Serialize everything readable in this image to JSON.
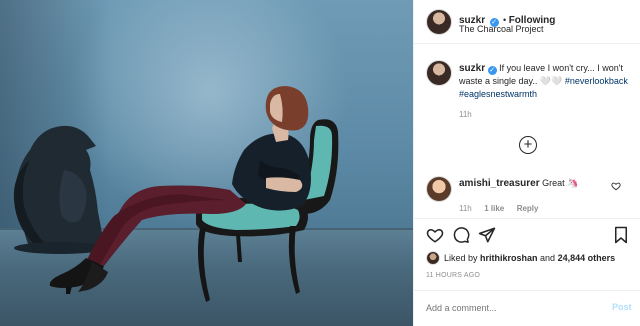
{
  "post": {
    "username": "suzkr",
    "follow_label": "Following",
    "location": "The Charcoal Project",
    "caption_text": "If you leave I won't cry... I won't waste a single day.. ",
    "caption_emoji": "🤍🤍",
    "hashtags": "#neverlookback #eaglesnestwarmth",
    "caption_time": "11h",
    "load_more": "+"
  },
  "comment": {
    "username": "amishi_treasurer",
    "text": "Great",
    "emoji": "🦄",
    "time": "11h",
    "likes": "1 like",
    "reply": "Reply"
  },
  "likes": {
    "prefix": "Liked by ",
    "user": "hrithikroshan",
    "mid": " and ",
    "count": "24,844 others",
    "timestamp": "11 HOURS AGO"
  },
  "composer": {
    "placeholder": "Add a comment...",
    "post_label": "Post"
  },
  "colors": {
    "link": "#003569",
    "verified": "#3897f0",
    "post_disabled": "#b2dffc"
  }
}
